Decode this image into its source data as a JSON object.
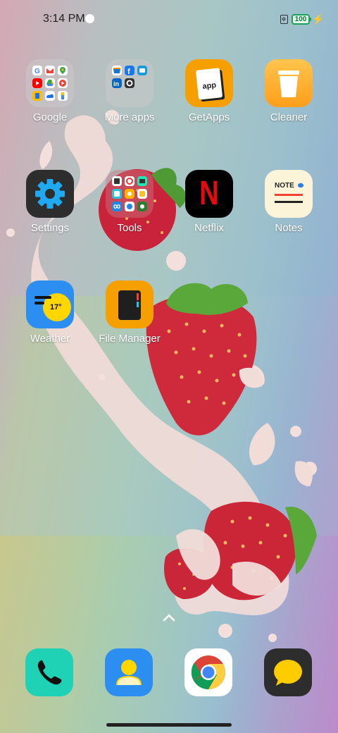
{
  "status_bar": {
    "time": "3:14 PM",
    "battery": "100"
  },
  "apps": [
    {
      "label": "Google",
      "icon": "google-folder-icon"
    },
    {
      "label": "More apps",
      "icon": "more-apps-folder-icon"
    },
    {
      "label": "GetApps",
      "icon": "getapps-icon",
      "badge_text": "app"
    },
    {
      "label": "Cleaner",
      "icon": "cleaner-icon"
    },
    {
      "label": "Settings",
      "icon": "settings-gear-icon"
    },
    {
      "label": "Tools",
      "icon": "tools-folder-icon"
    },
    {
      "label": "Netflix",
      "icon": "netflix-icon",
      "badge_text": "N"
    },
    {
      "label": "Notes",
      "icon": "notes-icon",
      "badge_text": "NOTE"
    },
    {
      "label": "Weather",
      "icon": "weather-icon",
      "badge_text": "17°"
    },
    {
      "label": "File Manager",
      "icon": "file-manager-icon"
    }
  ],
  "dock": [
    {
      "icon": "phone-icon"
    },
    {
      "icon": "contacts-icon"
    },
    {
      "icon": "chrome-icon"
    },
    {
      "icon": "messages-icon"
    }
  ],
  "colors": {
    "getapps": "#f5a000",
    "cleaner": "#ffb01f",
    "settings_bg": "#2d2d2d",
    "settings_gear": "#20a9f0",
    "netflix_bg": "#000000",
    "netflix_red": "#e50914",
    "notes_bg": "#fbf4d8",
    "weather_bg": "#2b8ef0",
    "weather_sun": "#ffd600",
    "file_manager": "#f5a000",
    "phone": "#1fd1b5",
    "contacts": "#2b8ef0",
    "messages_bg": "#2d2d2d",
    "messages_bubble": "#ffcc00"
  }
}
